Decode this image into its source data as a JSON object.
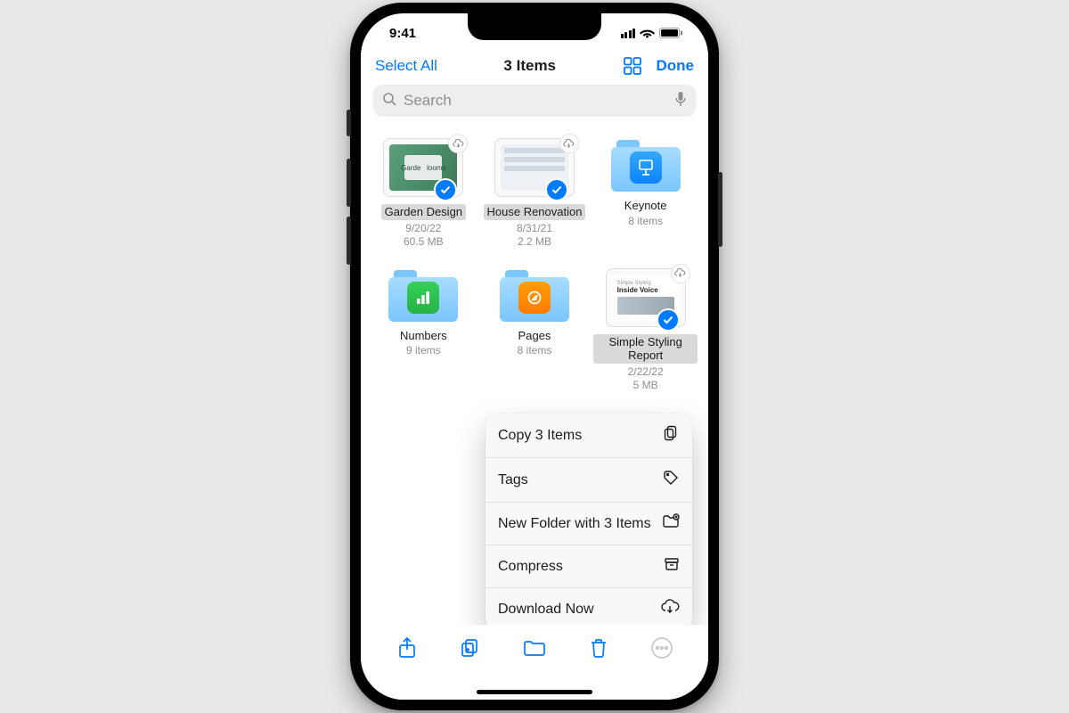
{
  "status": {
    "time": "9:41"
  },
  "nav": {
    "left": "Select All",
    "title": "3 Items",
    "done": "Done"
  },
  "search": {
    "placeholder": "Search"
  },
  "items": [
    {
      "name": "Garden Design",
      "date": "9/20/22",
      "size": "60.5 MB",
      "selected": true,
      "cloud": true
    },
    {
      "name": "House Renovation",
      "date": "8/31/21",
      "size": "2.2 MB",
      "selected": true,
      "cloud": true
    },
    {
      "name": "Keynote",
      "sub": "8 items",
      "selected": false,
      "cloud": false
    },
    {
      "name": "Numbers",
      "sub": "9 items",
      "selected": false,
      "cloud": false
    },
    {
      "name": "Pages",
      "sub": "8 items",
      "selected": false,
      "cloud": false
    },
    {
      "name": "Simple Styling Report",
      "date": "2/22/22",
      "size": "5 MB",
      "selected": true,
      "cloud": true
    }
  ],
  "menu": {
    "copy": "Copy 3 Items",
    "tags": "Tags",
    "newfolder": "New Folder with 3 Items",
    "compress": "Compress",
    "download": "Download Now"
  },
  "colors": {
    "accent": "#007AFF"
  }
}
